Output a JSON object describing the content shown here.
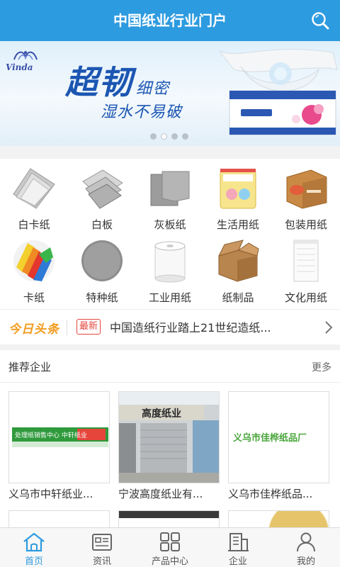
{
  "header": {
    "title": "中国纸业行业门户",
    "search_icon": "search-icon"
  },
  "banner": {
    "brand": "Vinda",
    "slogan_main": "超韧",
    "slogan_small": "细密",
    "slogan_sub": "湿水不易破",
    "slide_count": 4,
    "active_slide": 2
  },
  "categories": [
    {
      "label": "白卡纸",
      "icon": "white-card-paper-icon"
    },
    {
      "label": "白板",
      "icon": "white-board-icon"
    },
    {
      "label": "灰板纸",
      "icon": "gray-board-icon"
    },
    {
      "label": "生活用纸",
      "icon": "household-paper-icon"
    },
    {
      "label": "包装用纸",
      "icon": "packaging-paper-icon"
    },
    {
      "label": "卡纸",
      "icon": "cardstock-icon"
    },
    {
      "label": "特种纸",
      "icon": "specialty-paper-icon"
    },
    {
      "label": "工业用纸",
      "icon": "industrial-paper-icon"
    },
    {
      "label": "纸制品",
      "icon": "paper-products-icon"
    },
    {
      "label": "文化用纸",
      "icon": "cultural-paper-icon"
    }
  ],
  "news": {
    "brand": "今日头条",
    "tag": "最新",
    "headline": "中国造纸行业踏上21世纪造纸..."
  },
  "recommend": {
    "title": "推荐企业",
    "more": "更多",
    "companies": [
      {
        "name": "义乌市中轩纸业...",
        "sign": "处理纸销售中心 中轩纸业"
      },
      {
        "name": "宁波高度纸业有...",
        "sign": "高度纸业"
      },
      {
        "name": "义乌市佳桦纸品...",
        "sign": "义乌市佳桦纸品厂"
      }
    ]
  },
  "tabbar": [
    {
      "label": "首页",
      "icon": "home-icon",
      "active": true
    },
    {
      "label": "资讯",
      "icon": "news-icon",
      "active": false
    },
    {
      "label": "产品中心",
      "icon": "grid-icon",
      "active": false
    },
    {
      "label": "企业",
      "icon": "building-icon",
      "active": false
    },
    {
      "label": "我的",
      "icon": "user-icon",
      "active": false
    }
  ],
  "colors": {
    "primary": "#2d9be0",
    "accent": "#f39c1f",
    "tag_red": "#e6453c"
  }
}
